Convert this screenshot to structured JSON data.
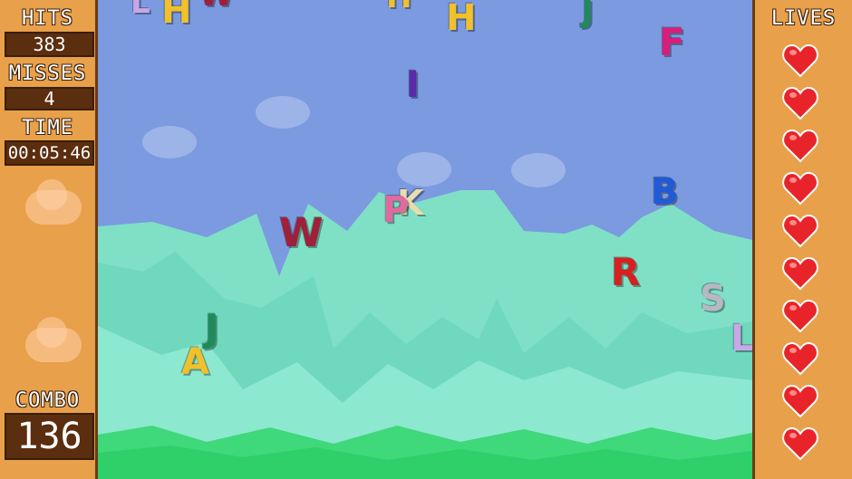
{
  "hud": {
    "hits_label": "HITS",
    "hits_value": "383",
    "misses_label": "MISSES",
    "misses_value": "4",
    "time_label": "TIME",
    "time_value": "00:05:46",
    "combo_label": "COMBO",
    "combo_value": "136",
    "lives_label": "LIVES",
    "lives_count": 10
  },
  "colors": {
    "panel": "#e8a04a",
    "panel_border": "#6b3a14",
    "stat_box": "#5a2e0e",
    "sky": "#7b9ae0",
    "mountain": "#7fe0c6",
    "grass": "#3fd87a",
    "heart": "#e8242a"
  },
  "falling_letters": [
    {
      "char": "L",
      "color": "#c9a6e8"
    },
    {
      "char": "H",
      "color": "#f0c12a"
    },
    {
      "char": "W",
      "color": "#a01f3a"
    },
    {
      "char": "H",
      "color": "#f0c12a"
    },
    {
      "char": "H",
      "color": "#f0c12a"
    },
    {
      "char": "J",
      "color": "#1f8a5a"
    },
    {
      "char": "F",
      "color": "#d81e7a"
    },
    {
      "char": "I",
      "color": "#5a2aa8"
    },
    {
      "char": "B",
      "color": "#1f5ad8"
    },
    {
      "char": "K",
      "color": "#e8dcb0"
    },
    {
      "char": "P",
      "color": "#e06aa0"
    },
    {
      "char": "W",
      "color": "#a01f3a"
    },
    {
      "char": "R",
      "color": "#d82020"
    },
    {
      "char": "S",
      "color": "#b8b8c0"
    },
    {
      "char": "L",
      "color": "#c9a6e8"
    },
    {
      "char": "J",
      "color": "#1f8a5a"
    },
    {
      "char": "A",
      "color": "#f0c12a"
    }
  ]
}
